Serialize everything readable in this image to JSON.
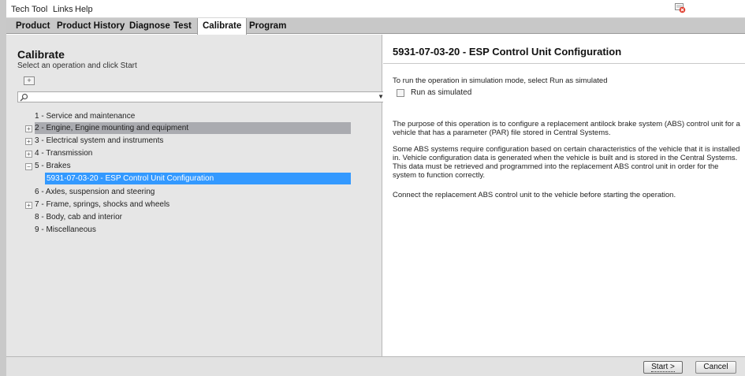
{
  "menubar": {
    "items": [
      "Tech Tool",
      "Links",
      "Help"
    ]
  },
  "tabs": [
    {
      "label": "Product"
    },
    {
      "label": "Product History"
    },
    {
      "label": "Diagnose"
    },
    {
      "label": "Test"
    },
    {
      "label": "Calibrate",
      "active": true
    },
    {
      "label": "Program"
    }
  ],
  "left": {
    "heading": "Calibrate",
    "subheading": "Select an operation and click Start",
    "expand_button": "+",
    "tree": [
      {
        "label": "1 - Service and maintenance",
        "toggle": ""
      },
      {
        "label": "2 - Engine, Engine mounting and equipment",
        "toggle": "+",
        "highlighted": true
      },
      {
        "label": "3 - Electrical system and instruments",
        "toggle": "+"
      },
      {
        "label": "4 - Transmission",
        "toggle": "+"
      },
      {
        "label": "5 - Brakes",
        "toggle": "-"
      },
      {
        "label": "5931-07-03-20 - ESP Control Unit Configuration",
        "child": true,
        "selected": true
      },
      {
        "label": "6 - Axles, suspension and steering",
        "toggle": ""
      },
      {
        "label": "7 - Frame, springs, shocks and wheels",
        "toggle": "+"
      },
      {
        "label": "8 - Body, cab and interior",
        "toggle": ""
      },
      {
        "label": "9 - Miscellaneous",
        "toggle": ""
      }
    ]
  },
  "right": {
    "title": "5931-07-03-20 - ESP Control Unit Configuration",
    "sim_instruction": "To run the operation in simulation mode, select Run as simulated",
    "run_simulated_label": "Run as simulated",
    "paragraphs": [
      "The purpose of this operation is to configure a replacement antilock brake system (ABS) control unit for a vehicle that has a parameter (PAR) file stored in Central Systems.",
      "Some ABS systems require configuration based on certain characteristics of the vehicle that it is installed in. Vehicle configuration data is generated when the vehicle is built and is stored in the Central Systems. This data must be retrieved and programmed into the replacement ABS control unit in order for the system to function correctly.",
      "Connect the replacement ABS control unit to the vehicle before starting the operation."
    ]
  },
  "buttons": {
    "start": "Start >",
    "cancel": "Cancel"
  },
  "colors": {
    "selected_row": "#3399ff",
    "highlighted_row": "#aaabb0",
    "tab_bar": "#c8c8c8"
  }
}
